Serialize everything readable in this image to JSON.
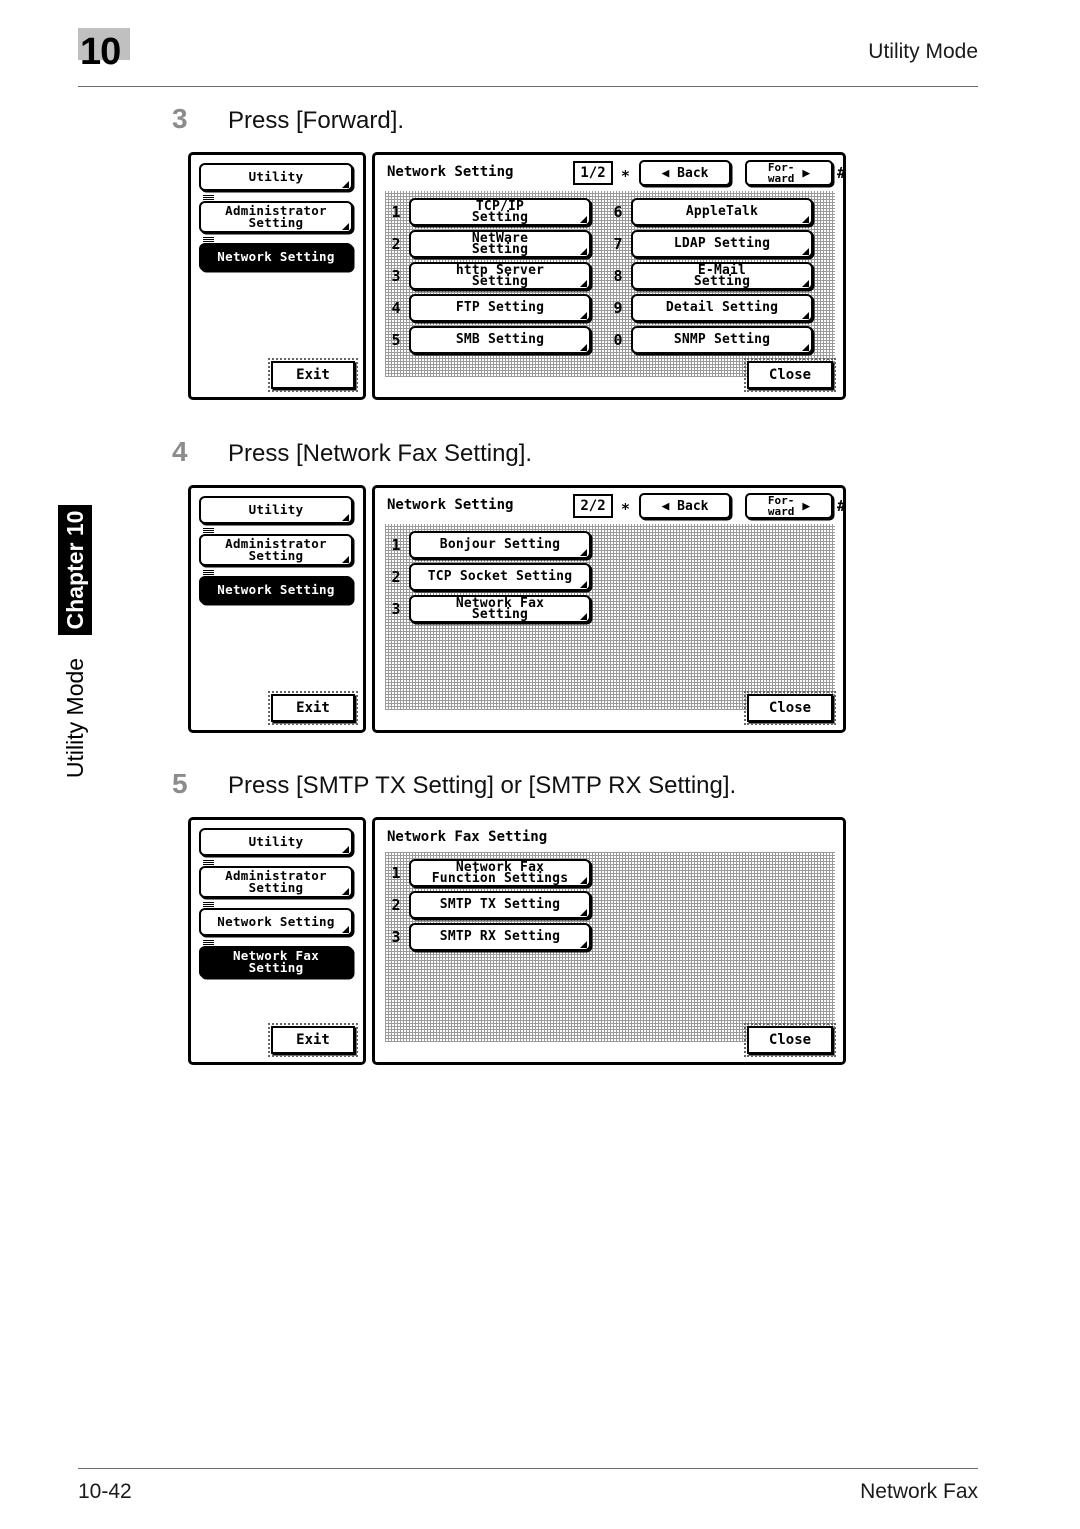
{
  "header": {
    "chapter_number": "10",
    "section_title": "Utility Mode"
  },
  "side_tab": {
    "chapter_label": "Chapter 10",
    "mode_label": "Utility Mode"
  },
  "footer": {
    "page_number": "10-42",
    "doc_section": "Network Fax"
  },
  "steps": [
    {
      "number": "3",
      "text": "Press [Forward]."
    },
    {
      "number": "4",
      "text": "Press [Network Fax Setting]."
    },
    {
      "number": "5",
      "text": "Press [SMTP TX Setting] or [SMTP RX Setting]."
    }
  ],
  "panels": [
    {
      "title": "Network Setting",
      "page_indicator": "1/2",
      "star_key": "∗",
      "hash_key": "#",
      "back_label": "Back",
      "forward_line1": "For-",
      "forward_line2": "ward",
      "close_label": "Close",
      "exit_label": "Exit",
      "tree": [
        {
          "label": "Utility",
          "selected": false,
          "lines": 1
        },
        {
          "label": "Administrator\nSetting",
          "selected": false,
          "lines": 2
        },
        {
          "label": "Network Setting",
          "selected": true,
          "lines": 1
        }
      ],
      "items_left": [
        {
          "number": "1",
          "label": "TCP/IP\nSetting"
        },
        {
          "number": "2",
          "label": "NetWare\nSetting"
        },
        {
          "number": "3",
          "label": "http Server\nSetting"
        },
        {
          "number": "4",
          "label": "FTP Setting"
        },
        {
          "number": "5",
          "label": "SMB Setting"
        }
      ],
      "items_right": [
        {
          "number": "6",
          "label": "AppleTalk"
        },
        {
          "number": "7",
          "label": "LDAP Setting"
        },
        {
          "number": "8",
          "label": "E-Mail\nSetting"
        },
        {
          "number": "9",
          "label": "Detail Setting"
        },
        {
          "number": "0",
          "label": "SNMP Setting"
        }
      ]
    },
    {
      "title": "Network Setting",
      "page_indicator": "2/2",
      "star_key": "∗",
      "hash_key": "#",
      "back_label": "Back",
      "forward_line1": "For-",
      "forward_line2": "ward",
      "close_label": "Close",
      "exit_label": "Exit",
      "tree": [
        {
          "label": "Utility",
          "selected": false,
          "lines": 1
        },
        {
          "label": "Administrator\nSetting",
          "selected": false,
          "lines": 2
        },
        {
          "label": "Network Setting",
          "selected": true,
          "lines": 1
        }
      ],
      "items_left": [
        {
          "number": "1",
          "label": "Bonjour Setting"
        },
        {
          "number": "2",
          "label": "TCP Socket Setting"
        },
        {
          "number": "3",
          "label": "Network Fax\nSetting"
        }
      ],
      "items_right": []
    },
    {
      "title": "Network Fax Setting",
      "page_indicator": "",
      "star_key": "",
      "hash_key": "",
      "back_label": "",
      "forward_line1": "",
      "forward_line2": "",
      "close_label": "Close",
      "exit_label": "Exit",
      "tree": [
        {
          "label": "Utility",
          "selected": false,
          "lines": 1
        },
        {
          "label": "Administrator\nSetting",
          "selected": false,
          "lines": 2
        },
        {
          "label": "Network Setting",
          "selected": false,
          "lines": 1
        },
        {
          "label": "Network Fax\nSetting",
          "selected": true,
          "lines": 2
        }
      ],
      "items_left": [
        {
          "number": "1",
          "label": "Network Fax\nFunction Settings"
        },
        {
          "number": "2",
          "label": "SMTP TX Setting"
        },
        {
          "number": "3",
          "label": "SMTP RX Setting"
        }
      ],
      "items_right": []
    }
  ]
}
